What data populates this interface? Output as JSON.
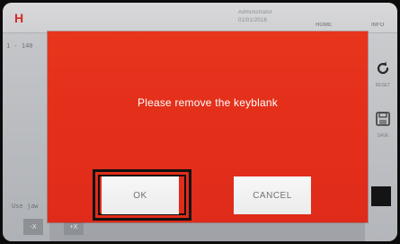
{
  "header": {
    "logo_letter": "H",
    "user_line_1": "Administrator",
    "user_line_2": "01/01/2016",
    "home_label": "HOME",
    "info_label": "INFO"
  },
  "background": {
    "left_value": "1 - 140",
    "left_caption": "Use jaw",
    "mini_buttons": [
      "-X",
      "+X"
    ]
  },
  "toolbar": {
    "reset_label": "RESET",
    "save_label": "SAVE"
  },
  "dialog": {
    "message": "Please remove the keyblank",
    "ok_label": "OK",
    "cancel_label": "CANCEL"
  },
  "colors": {
    "dialog_red": "#e4301b",
    "button_bg": "#f2f2f2",
    "button_text": "#727272",
    "focus_frame": "#111111"
  }
}
